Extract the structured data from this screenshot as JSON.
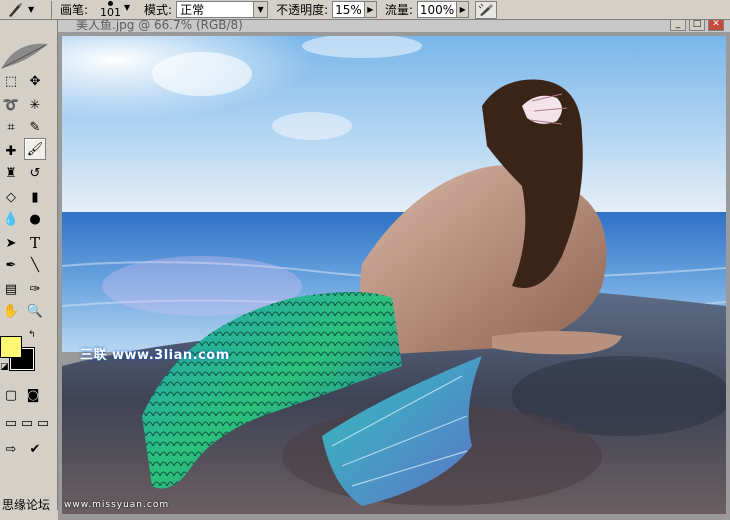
{
  "options_bar": {
    "brush_label": "画笔:",
    "brush_size": "101",
    "mode_label": "模式:",
    "mode_value": "正常",
    "opacity_label": "不透明度:",
    "opacity_value": "15%",
    "flow_label": "流量:",
    "flow_value": "100%"
  },
  "document": {
    "title": "美人鱼.jpg @ 66.7% (RGB/8)"
  },
  "toolbox": {
    "foreground_color": "#fef874",
    "background_color": "#000000",
    "text_tool_glyph": "T"
  },
  "watermarks": {
    "site_3lian": "三联 www.3lian.com",
    "site_missyuan": "www.missyuan.com",
    "forum": "思缘论坛"
  },
  "icons": [
    "brush-icon",
    "chevron-down-icon",
    "airbrush-icon",
    "feather-icon",
    "marquee-icon",
    "move-icon",
    "lasso-icon",
    "magic-wand-icon",
    "crop-icon",
    "slice-icon",
    "healing-icon",
    "brush-tool-icon",
    "stamp-icon",
    "history-brush-icon",
    "eraser-icon",
    "gradient-icon",
    "blur-icon",
    "dodge-icon",
    "path-select-icon",
    "type-icon",
    "pen-icon",
    "line-icon",
    "notes-icon",
    "eyedropper-icon",
    "hand-icon",
    "zoom-icon",
    "quickmask-icon",
    "screen-mode-icon",
    "imageready-icon"
  ]
}
